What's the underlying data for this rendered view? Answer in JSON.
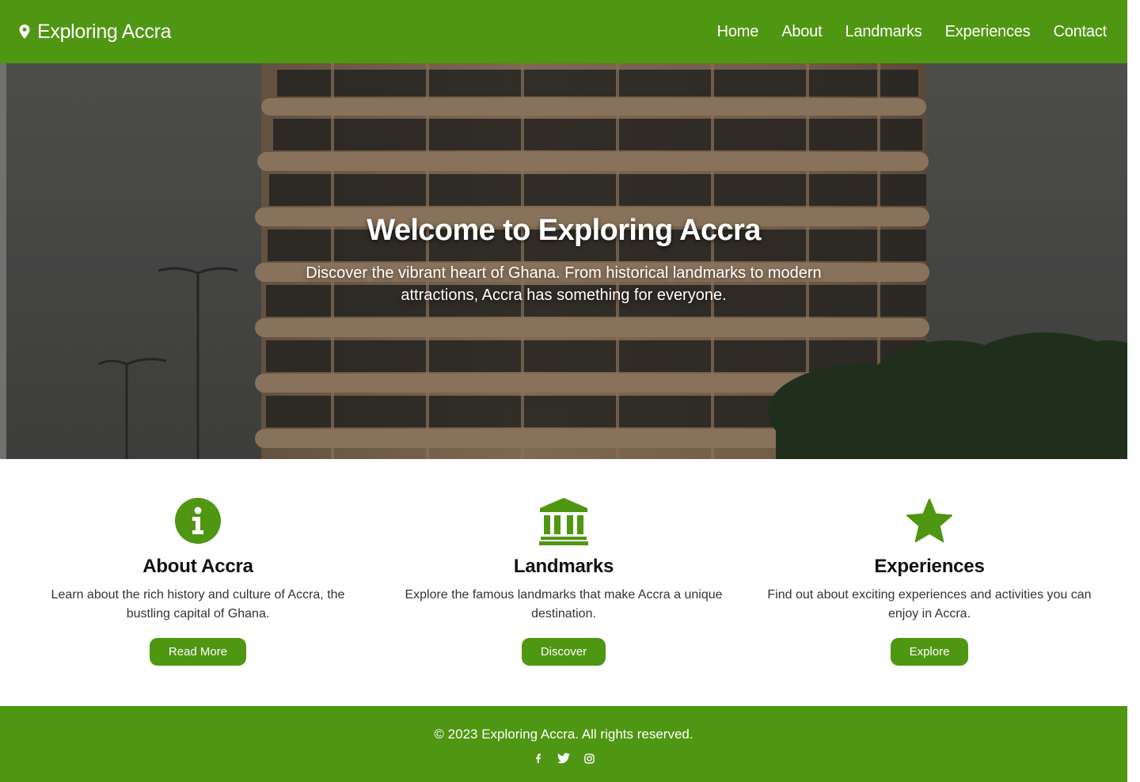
{
  "brand": {
    "name": "Exploring Accra",
    "icon": "map-pin-icon"
  },
  "nav": {
    "items": [
      {
        "label": "Home"
      },
      {
        "label": "About"
      },
      {
        "label": "Landmarks"
      },
      {
        "label": "Experiences"
      },
      {
        "label": "Contact"
      }
    ]
  },
  "hero": {
    "title": "Welcome to Exploring Accra",
    "subtitle": "Discover the vibrant heart of Ghana. From historical landmarks to modern attractions, Accra has something for everyone."
  },
  "features": [
    {
      "icon": "info-circle-icon",
      "title": "About Accra",
      "text": "Learn about the rich history and culture of Accra, the bustling capital of Ghana.",
      "button": "Read More"
    },
    {
      "icon": "landmark-icon",
      "title": "Landmarks",
      "text": "Explore the famous landmarks that make Accra a unique destination.",
      "button": "Discover"
    },
    {
      "icon": "star-icon",
      "title": "Experiences",
      "text": "Find out about exciting experiences and activities you can enjoy in Accra.",
      "button": "Explore"
    }
  ],
  "footer": {
    "text": "© 2023 Exploring Accra. All rights reserved.",
    "socials": [
      "facebook-icon",
      "twitter-icon",
      "instagram-icon"
    ]
  },
  "colors": {
    "primary": "#4f9612",
    "text_dark": "#111111",
    "text_body": "#333333"
  }
}
